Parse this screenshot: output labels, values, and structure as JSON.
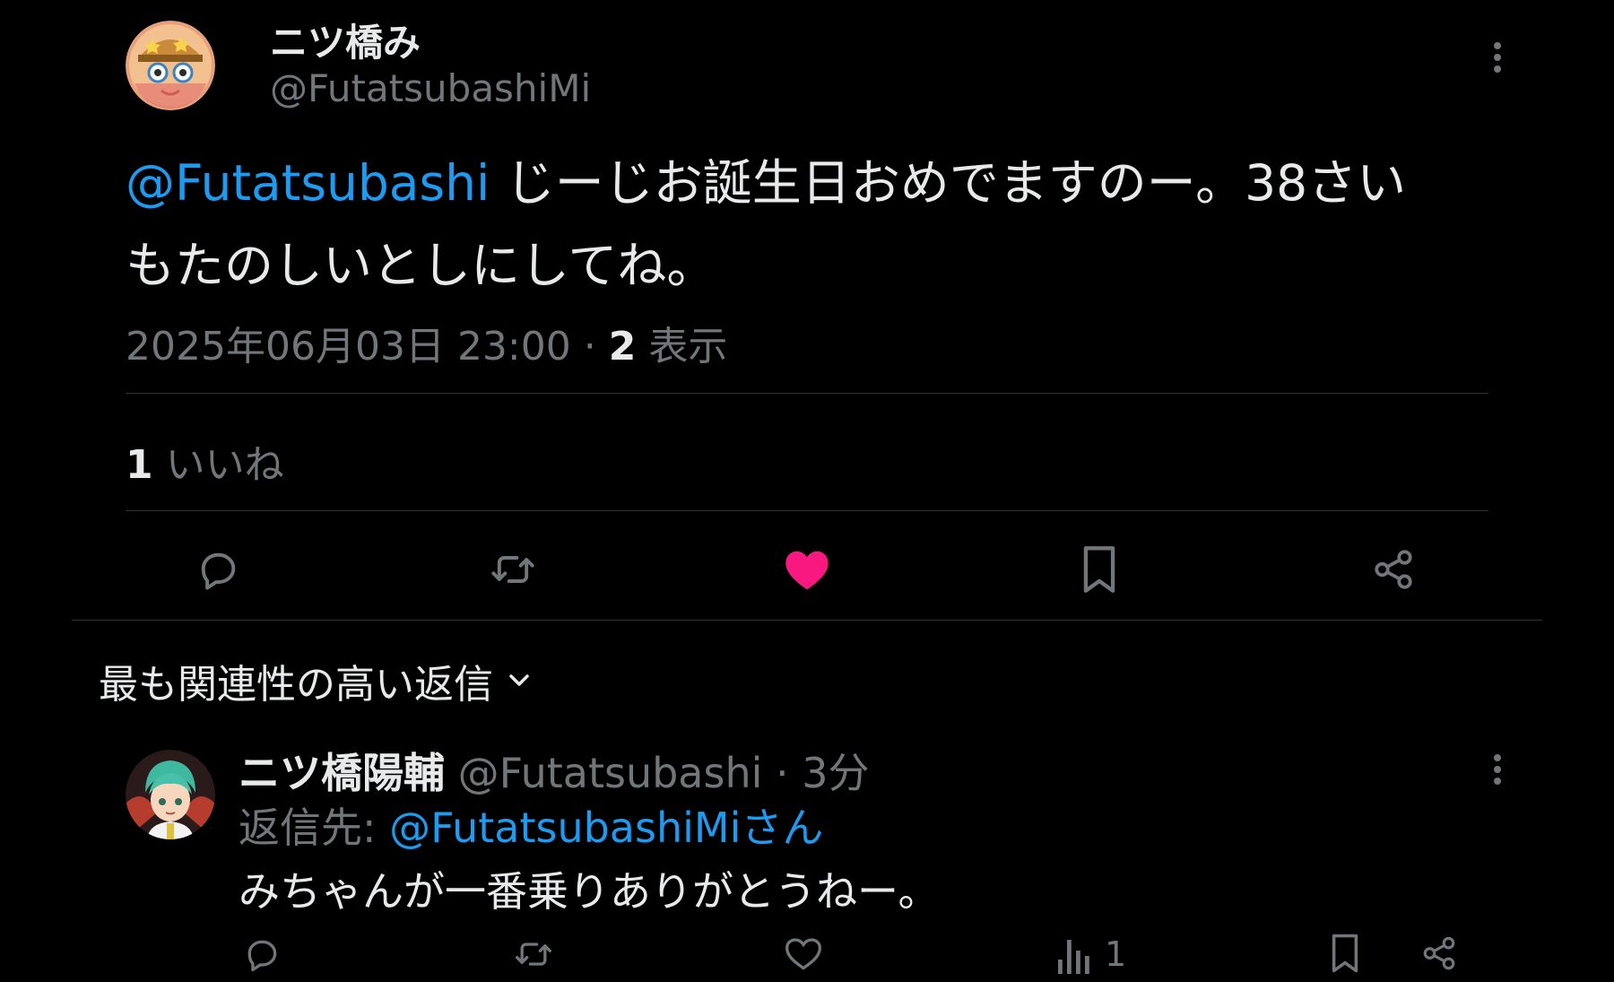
{
  "main_tweet": {
    "author_name": "ニツ橋み",
    "author_handle": "@FutatsubashiMi",
    "mention": "@Futatsubashi",
    "text_line1": " じーじお誕生日おめでますのー。38さい",
    "text_line2": "もたのしいとしにしてね。",
    "timestamp": "2025年06月03日 23:00",
    "separator": " · ",
    "views_count": "2",
    "views_label": " 表示",
    "likes_count": "1",
    "likes_label": " いいね",
    "liked": true,
    "actions": [
      "reply-icon",
      "retweet-icon",
      "heart-filled-icon",
      "bookmark-icon",
      "share-icon"
    ]
  },
  "replies_sort": {
    "label": "最も関連性の高い返信"
  },
  "reply": {
    "author_name": "ニツ橋陽輔",
    "author_handle": " @Futatsubashi",
    "time": " · 3分",
    "reply_to_label": "返信先: ",
    "reply_to_handle": "@FutatsubashiMiさん",
    "text": "みちゃんが一番乗りありがとうねー。",
    "views_count": "1",
    "actions": [
      "reply-icon",
      "retweet-icon",
      "heart-icon",
      "views-icon",
      "bookmark-icon",
      "share-icon"
    ]
  },
  "colors": {
    "background": "#000000",
    "text": "#e7e9ea",
    "secondary": "#71767b",
    "link": "#1d9bf0",
    "like": "#f91880",
    "divider": "#2f3336"
  }
}
